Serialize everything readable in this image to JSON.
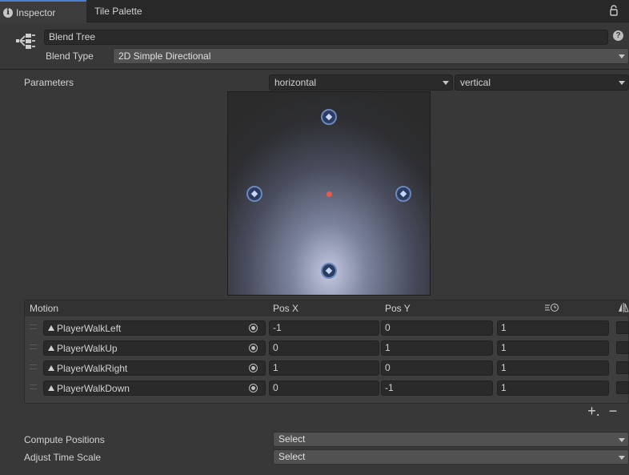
{
  "tabs": [
    {
      "label": "Inspector",
      "icon": "info-icon",
      "active": true
    },
    {
      "label": "Tile Palette",
      "active": false
    }
  ],
  "header": {
    "icon": "blend-tree-icon",
    "name": "Blend Tree",
    "blend_type_label": "Blend Type",
    "blend_type_value": "2D Simple Directional"
  },
  "parameters": {
    "label": "Parameters",
    "x": "horizontal",
    "y": "vertical"
  },
  "graph": {
    "motion_points": [
      {
        "clip": "PlayerWalkLeft",
        "x": -1,
        "y": 0
      },
      {
        "clip": "PlayerWalkUp",
        "x": 0,
        "y": 1
      },
      {
        "clip": "PlayerWalkRight",
        "x": 1,
        "y": 0
      },
      {
        "clip": "PlayerWalkDown",
        "x": 0,
        "y": -1
      }
    ],
    "current": {
      "x": 0,
      "y": 0
    },
    "accent_color": "#e85a4a"
  },
  "motion_table": {
    "headers": {
      "motion": "Motion",
      "pos_x": "Pos X",
      "pos_y": "Pos Y",
      "time_scale_icon": "time-scale-icon",
      "mirror_icon": "mirror-icon"
    },
    "rows": [
      {
        "clip": "PlayerWalkLeft",
        "pos_x": "-1",
        "pos_y": "0",
        "speed": "1"
      },
      {
        "clip": "PlayerWalkUp",
        "pos_x": "0",
        "pos_y": "1",
        "speed": "1"
      },
      {
        "clip": "PlayerWalkRight",
        "pos_x": "1",
        "pos_y": "0",
        "speed": "1"
      },
      {
        "clip": "PlayerWalkDown",
        "pos_x": "0",
        "pos_y": "-1",
        "speed": "1"
      }
    ],
    "add_label": "+.",
    "remove_label": "−"
  },
  "footer": {
    "compute_label": "Compute Positions",
    "compute_value": "Select",
    "adjust_label": "Adjust Time Scale",
    "adjust_value": "Select"
  }
}
